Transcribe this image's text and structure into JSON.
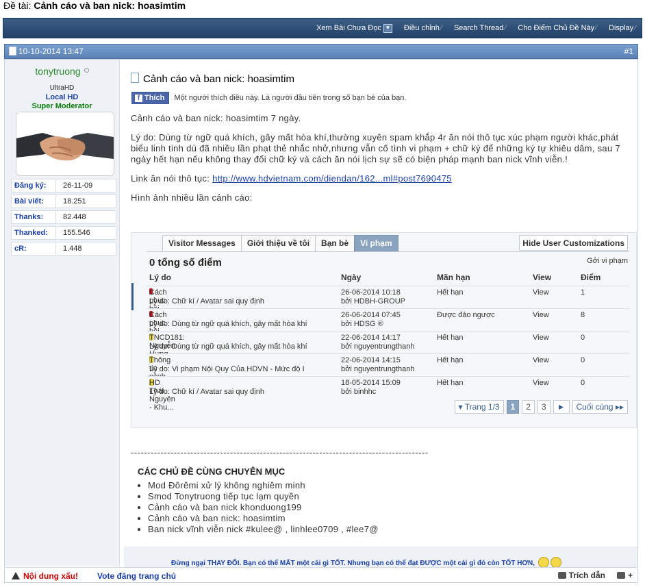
{
  "topic": {
    "prefix": "Đề tài:",
    "title": "Cảnh cáo và ban nick: hoasimtim"
  },
  "navbar": {
    "items": [
      "Xem Bài Chưa Đọc",
      "Điều chỉnh",
      "Search Thread",
      "Cho Điểm Chủ Đề Này",
      "Display"
    ]
  },
  "post": {
    "date": "10-10-2014 13:47",
    "number": "#1"
  },
  "user": {
    "name": "tonytruong",
    "title": "UltraHD",
    "rank1": "Local HD",
    "rank2": "Super Moderator",
    "stats": [
      {
        "k": "Đăng ký:",
        "v": "26-11-09"
      },
      {
        "k": "Bài viết:",
        "v": "18.251"
      },
      {
        "k": "Thanks:",
        "v": "82.448"
      },
      {
        "k": "Thanked:",
        "v": "155.546"
      },
      {
        "k": "cR:",
        "v": "1.448"
      }
    ]
  },
  "content": {
    "title": "Cảnh cáo và ban nick: hoasimtim",
    "fb_button": "Thích",
    "fb_text": "Một người thích điều này. Là người đầu tiên trong số bạn bè của bạn.",
    "line1": "Cảnh cáo và ban nick: hoasimtim 7 ngày.",
    "reason": "Lý do: Dùng từ ngữ quá khích, gây mất hòa khí,thường xuyên spam khắp 4r ăn nói thô tục xúc phạm người khác,phát biểu linh tinh dù đã nhiều lần phạt thẻ nhắc nhở,nhưng vẫn cố tình vi phạm + chữ ký để những ký tự khiêu dâm, sau 7 ngày hết hạn nếu không thay đổi chữ ký và cách ăn nói lịch sự sẽ có biện pháp mạnh ban nick vĩnh viễn.!",
    "link_label": "Link ăn nói thô tục:",
    "link": "http://www.hdvietnam.com/diendan/162...ml#post7690475",
    "images_label": "Hình ảnh nhiều lần cảnh cáo:"
  },
  "screenshot": {
    "tabs": [
      "Visitor Messages",
      "Giới thiệu về tôi",
      "Bạn bè",
      "Vi phạm"
    ],
    "hide_button": "Hide User Customizations",
    "total": "0 tổng số điểm",
    "send": "Gởi vi phạm",
    "headers": [
      "Lý do",
      "Ngày",
      "Mãn hạn",
      "View",
      "Điểm"
    ],
    "rows": [
      {
        "color": "red",
        "name": "Cách phục hồi Pin...",
        "reason": "Lý do: Chữ kí / Avatar sai quy định",
        "date": "26-06-2014 10:18",
        "by": "bởi HDBH-GROUP",
        "status": "Hết hạn",
        "view": "View",
        "points": "1"
      },
      {
        "color": "red",
        "name": "Cách phục hồi Pin...",
        "reason": "Lý do: Dùng từ ngữ quá khích, gây mất hòa khí",
        "date": "26-06-2014 07:45",
        "by": "bởi HDSG ®",
        "status": "Được đảo ngược",
        "view": "View",
        "points": "8"
      },
      {
        "color": "yellow",
        "name": "TNCD181: Nguyễn Hưng -...",
        "reason": "Lý do: Dùng từ ngữ quá khích, gây mất hòa khí",
        "date": "22-06-2014 14:17",
        "by": "bởi nguyentrungthanh",
        "status": "Hết hạn",
        "view": "View",
        "points": "0"
      },
      {
        "color": "yellow",
        "name": "Thông tin cảnh cáo",
        "reason": "Lý do: Vi phạm Nội Quy Của HDVN - Mức độ I",
        "date": "22-06-2014 14:15",
        "by": "bởi nguyentrungthanh",
        "status": "Hết hạn",
        "view": "View",
        "points": "0"
      },
      {
        "color": "yellow",
        "name": "HD Thái Nguyên - Khu...",
        "reason": "Lý do: Chữ kí / Avatar sai quy định",
        "date": "18-05-2014 15:09",
        "by": "bởi binhhc",
        "status": "Hết hạn",
        "view": "View",
        "points": "0"
      }
    ],
    "pager": {
      "page_label": "Trang 1/3",
      "pages": [
        "1",
        "2",
        "3"
      ],
      "next": "►",
      "last": "Cuối cùng"
    }
  },
  "dashes": "------------------------------------------------------------------------------------------",
  "related": {
    "heading": "CÁC CHỦ ĐỀ CÙNG CHUYÊN MỤC",
    "items": [
      "Mod Đôrêmi xử lý không nghiêm minh",
      "Smod Tonytruong tiếp tục lạm quyền",
      "Cảnh cáo và ban nick khonduong199",
      "Cảnh cáo và ban nick: hoasimtim",
      "Ban nick vĩnh viễn nick #kulee@ , linhlee0709 , #lee7@"
    ]
  },
  "signature": "Đừng ngại THAY ĐỔI. Bạn có thể MẤT một cái gì TỐT. Nhưng bạn có thể đạt ĐƯỢC một cái gì đó còn TỐT HƠN,",
  "footer": {
    "report": "Nội dung xấu!",
    "vote": "Vote đăng trang chủ",
    "quote": "Trích dẫn",
    "multi": "+"
  },
  "colors": {
    "navbar": "#2c4c76",
    "postbar": "#6a91c4",
    "username": "#2b8a2b",
    "link": "#1a3fa3",
    "tab_active": "#8aa3bf"
  }
}
